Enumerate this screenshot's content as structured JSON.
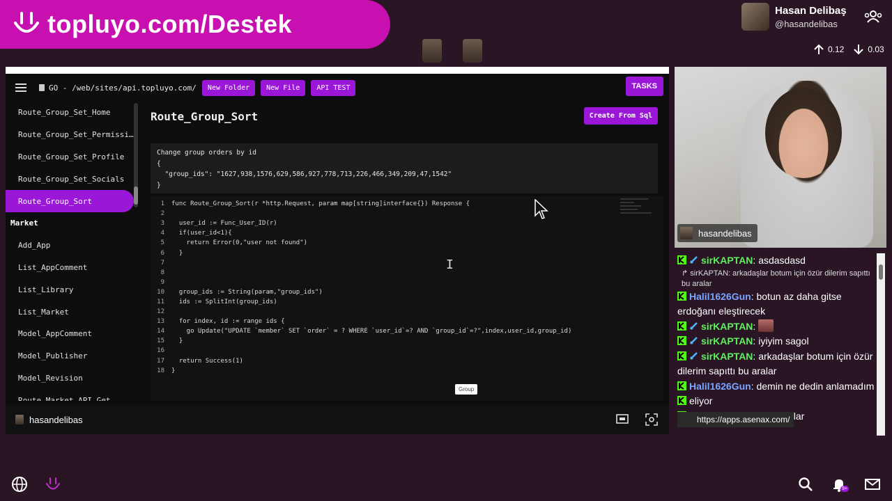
{
  "banner": {
    "text": "topluyo.com/Destek"
  },
  "streamer": {
    "name": "Hasan Delibaş",
    "handle": "@hasandelibas"
  },
  "net": {
    "up": "0.12",
    "down": "0.03"
  },
  "ide": {
    "path": "GO - /web/sites/api.topluyo.com/",
    "buttons": {
      "new_folder": "New Folder",
      "new_file": "New File",
      "api_test": "API TEST",
      "tasks": "TASKS"
    },
    "sidebar": [
      {
        "label": "Route_Group_Set_Home",
        "kind": "item"
      },
      {
        "label": "Route_Group_Set_Permissi…",
        "kind": "item"
      },
      {
        "label": "Route_Group_Set_Profile",
        "kind": "item"
      },
      {
        "label": "Route_Group_Set_Socials",
        "kind": "item"
      },
      {
        "label": "Route_Group_Sort",
        "kind": "active"
      },
      {
        "label": "Market",
        "kind": "group"
      },
      {
        "label": "Add_App",
        "kind": "item"
      },
      {
        "label": "List_AppComment",
        "kind": "item"
      },
      {
        "label": "List_Library",
        "kind": "item"
      },
      {
        "label": "List_Market",
        "kind": "item"
      },
      {
        "label": "Model_AppComment",
        "kind": "item"
      },
      {
        "label": "Model_Publisher",
        "kind": "item"
      },
      {
        "label": "Model_Revision",
        "kind": "item"
      },
      {
        "label": "Route_Market_API_Get",
        "kind": "item"
      }
    ],
    "title": "Route_Group_Sort",
    "create_btn": "Create From Sql",
    "description": "Change group orders by id\n{\n  \"group_ids\": \"1627,938,1576,629,586,927,778,713,226,466,349,209,47,1542\"\n}",
    "code": [
      "func Route_Group_Sort(r *http.Request, param map[string]interface{}) Response {",
      "",
      "  user_id := Func_User_ID(r)",
      "  if(user_id<1){",
      "    return Error(0,\"user not found\")",
      "  }",
      "",
      "",
      "",
      "  group_ids := String(param,\"group_ids\")",
      "  ids := SplitInt(group_ids)",
      "",
      "  for index, id := range ids {",
      "    go Update(\"UPDATE `member` SET `order` = ? WHERE `user_id`=? AND `group_id`=?\",index,user_id,group_id)",
      "  }",
      "",
      "  return Success(1)",
      "}"
    ],
    "tooltip": "Group",
    "footer_name": "hasandelibas"
  },
  "cam": {
    "label": "hasandelibas"
  },
  "chat": [
    {
      "user": "sirKAPTAN",
      "color": "green",
      "mod": true,
      "text": "asdasdasd"
    },
    {
      "reply": "↱ sirKAPTAN: arkadaşlar botum için özür dilerim sapıttı bu aralar"
    },
    {
      "user": "Halil1626Gun",
      "color": "blue",
      "mod": false,
      "text": "botun az daha gitse erdoğanı eleştirecek"
    },
    {
      "user": "sirKAPTAN",
      "color": "green",
      "mod": true,
      "text": "",
      "emote": true
    },
    {
      "user": "sirKAPTAN",
      "color": "green",
      "mod": true,
      "text": "iyiyim sagol"
    },
    {
      "user": "sirKAPTAN",
      "color": "green",
      "mod": true,
      "text": "arkadaşlar botum için özür dilerim sapıttı bu aralar"
    },
    {
      "user": "Halil1626Gun",
      "color": "blue",
      "mod": false,
      "text": "demin ne dedin anlamadım"
    },
    {
      "user": "",
      "color": "green",
      "mod": false,
      "text": "eliyor"
    },
    {
      "user": "sirKAPTAN",
      "color": "green",
      "mod": true,
      "text": "iyi yayınlar"
    }
  ],
  "url_popup": "https://apps.asenax.com/",
  "colors": {
    "accent": "#9a17d8",
    "banner": "#c80fb0",
    "bg": "#2a1525"
  }
}
